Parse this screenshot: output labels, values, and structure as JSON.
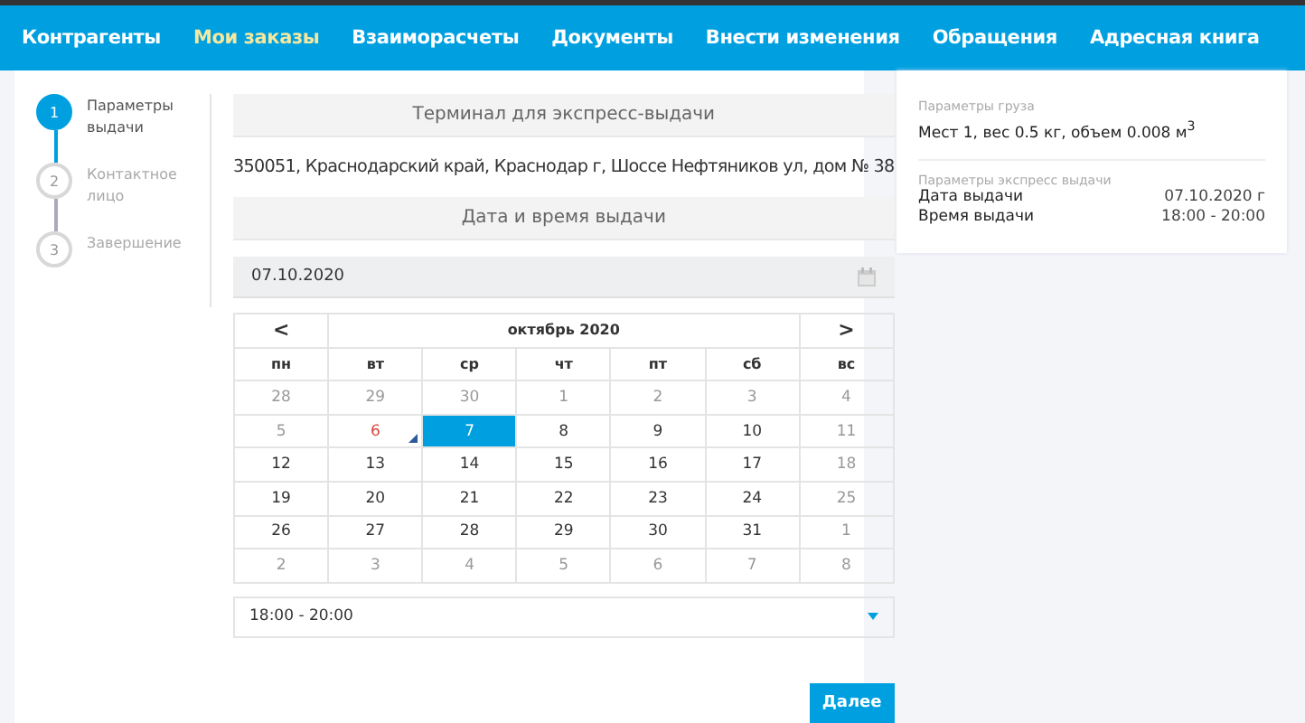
{
  "nav": [
    {
      "label": "Контрагенты",
      "selected": false
    },
    {
      "label": "Мои заказы",
      "selected": true
    },
    {
      "label": "Взаиморасчеты",
      "selected": false
    },
    {
      "label": "Документы",
      "selected": false
    },
    {
      "label": "Внести изменения",
      "selected": false
    },
    {
      "label": "Обращения",
      "selected": false
    },
    {
      "label": "Адресная книга",
      "selected": false
    }
  ],
  "steps": [
    {
      "number": "1",
      "label": "Параметры выдачи",
      "selected": true
    },
    {
      "number": "2",
      "label": "Контактное лицо",
      "selected": false
    },
    {
      "number": "3",
      "label": "Завершение",
      "selected": false
    }
  ],
  "terminal": {
    "heading": "Терминал для экспресс-выдачи",
    "address": "350051, Краснодарский край, Краснодар г, Шоссе Нефтяников ул, дом № 38"
  },
  "datetime": {
    "heading": "Дата и время выдачи",
    "date_value": "07.10.2020"
  },
  "calendar": {
    "prev": "<",
    "month": "октябрь 2020",
    "next": ">",
    "weekdays": [
      "пн",
      "вт",
      "ср",
      "чт",
      "пт",
      "сб",
      "вс"
    ],
    "days": [
      {
        "day": "28",
        "kind": "muted",
        "selected": false
      },
      {
        "day": "29",
        "kind": "muted",
        "selected": false
      },
      {
        "day": "30",
        "kind": "muted",
        "selected": false
      },
      {
        "day": "1",
        "kind": "muted",
        "selected": false
      },
      {
        "day": "2",
        "kind": "muted",
        "selected": false
      },
      {
        "day": "3",
        "kind": "muted",
        "selected": false
      },
      {
        "day": "4",
        "kind": "muted",
        "selected": false
      },
      {
        "day": "5",
        "kind": "muted",
        "selected": false
      },
      {
        "day": "6",
        "kind": "today",
        "selected": false
      },
      {
        "day": "7",
        "kind": "normal",
        "selected": true
      },
      {
        "day": "8",
        "kind": "normal",
        "selected": false
      },
      {
        "day": "9",
        "kind": "normal",
        "selected": false
      },
      {
        "day": "10",
        "kind": "normal",
        "selected": false
      },
      {
        "day": "11",
        "kind": "muted",
        "selected": false
      },
      {
        "day": "12",
        "kind": "normal",
        "selected": false
      },
      {
        "day": "13",
        "kind": "normal",
        "selected": false
      },
      {
        "day": "14",
        "kind": "normal",
        "selected": false
      },
      {
        "day": "15",
        "kind": "normal",
        "selected": false
      },
      {
        "day": "16",
        "kind": "normal",
        "selected": false
      },
      {
        "day": "17",
        "kind": "normal",
        "selected": false
      },
      {
        "day": "18",
        "kind": "muted",
        "selected": false
      },
      {
        "day": "19",
        "kind": "normal",
        "selected": false
      },
      {
        "day": "20",
        "kind": "normal",
        "selected": false
      },
      {
        "day": "21",
        "kind": "normal",
        "selected": false
      },
      {
        "day": "22",
        "kind": "normal",
        "selected": false
      },
      {
        "day": "23",
        "kind": "normal",
        "selected": false
      },
      {
        "day": "24",
        "kind": "normal",
        "selected": false
      },
      {
        "day": "25",
        "kind": "muted",
        "selected": false
      },
      {
        "day": "26",
        "kind": "normal",
        "selected": false
      },
      {
        "day": "27",
        "kind": "normal",
        "selected": false
      },
      {
        "day": "28",
        "kind": "normal",
        "selected": false
      },
      {
        "day": "29",
        "kind": "normal",
        "selected": false
      },
      {
        "day": "30",
        "kind": "normal",
        "selected": false
      },
      {
        "day": "31",
        "kind": "normal",
        "selected": false
      },
      {
        "day": "1",
        "kind": "muted",
        "selected": false
      },
      {
        "day": "2",
        "kind": "muted",
        "selected": false
      },
      {
        "day": "3",
        "kind": "muted",
        "selected": false
      },
      {
        "day": "4",
        "kind": "muted",
        "selected": false
      },
      {
        "day": "5",
        "kind": "muted",
        "selected": false
      },
      {
        "day": "6",
        "kind": "muted",
        "selected": false
      },
      {
        "day": "7",
        "kind": "muted",
        "selected": false
      },
      {
        "day": "8",
        "kind": "muted",
        "selected": false
      }
    ]
  },
  "time_select": {
    "value": "18:00 - 20:00"
  },
  "next_button": "Далее",
  "summary": {
    "cargo_label": "Параметры груза",
    "cargo_value": "Мест 1, вес 0.5 кг, объем 0.008 м$^{3}$",
    "express_label": "Параметры экспресс выдачи",
    "rows": [
      {
        "label": "Дата выдачи",
        "value": "07.10.2020 г"
      },
      {
        "label": "Время выдачи",
        "value": "18:00 - 20:00"
      }
    ]
  }
}
